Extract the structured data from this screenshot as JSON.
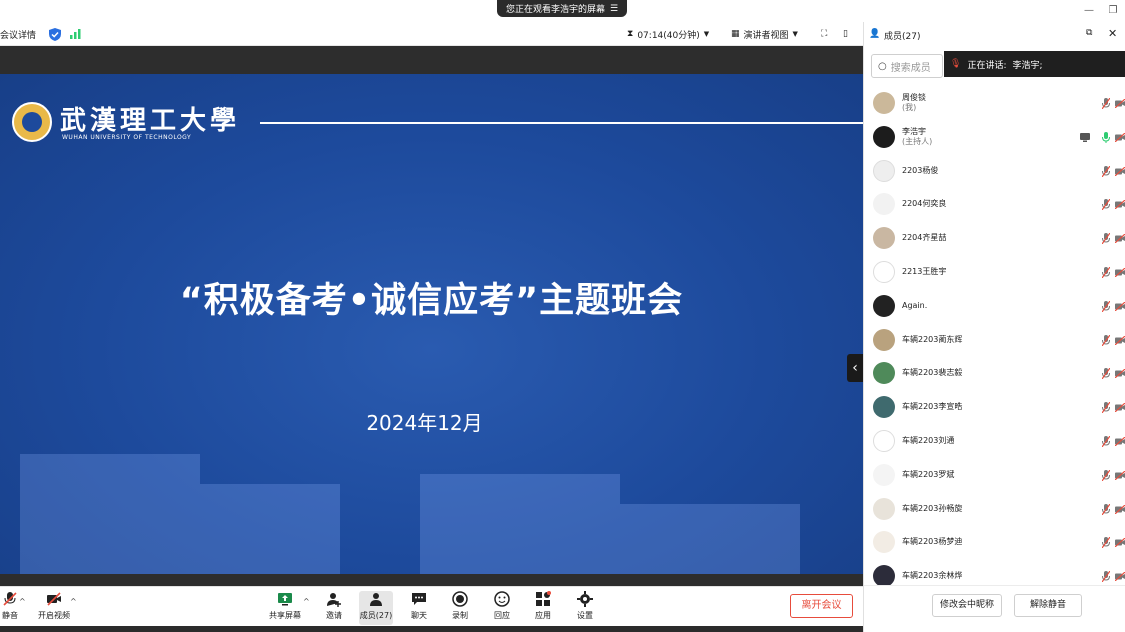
{
  "titlebar": {
    "sharing_notice": "您正在观看李浩宇的屏幕",
    "sharing_menu_icon": "menu-icon"
  },
  "toolbar": {
    "meeting_info": "会议详情",
    "timer": "07:14(40分钟)",
    "view_mode": "演讲者视图"
  },
  "slide": {
    "university_cn": "武漢理工大學",
    "university_en": "WUHAN UNIVERSITY OF TECHNOLOGY",
    "title": "“积极备考•诚信应考”主题班会",
    "date": "2024年12月"
  },
  "controls": {
    "mute": "静音",
    "video": "开启视频",
    "share": "共享屏幕",
    "invite": "邀请",
    "members": "成员(27)",
    "chat": "聊天",
    "record": "录制",
    "replay": "回应",
    "apps": "应用",
    "settings": "设置",
    "leave": "离开会议"
  },
  "panel": {
    "header": "成员(27)",
    "search_placeholder": "搜索成员",
    "speaking_label": "正在讲话:",
    "speaking_name": "李浩宇;",
    "members": [
      {
        "name": "周俊锬",
        "sub": "(我)"
      },
      {
        "name": "李浩宇",
        "sub": "(主持人)"
      },
      {
        "name": "2203杨俊",
        "sub": ""
      },
      {
        "name": "2204何奕良",
        "sub": ""
      },
      {
        "name": "2204齐星喆",
        "sub": ""
      },
      {
        "name": "2213王胜宇",
        "sub": ""
      },
      {
        "name": "Again.",
        "sub": ""
      },
      {
        "name": "车辆2203蔺东辉",
        "sub": ""
      },
      {
        "name": "车辆2203裴志毅",
        "sub": ""
      },
      {
        "name": "车辆2203李宣晧",
        "sub": ""
      },
      {
        "name": "车辆2203刘通",
        "sub": ""
      },
      {
        "name": "车辆2203罗斌",
        "sub": ""
      },
      {
        "name": "车辆2203孙畅旋",
        "sub": ""
      },
      {
        "name": "车辆2203杨梦迪",
        "sub": ""
      },
      {
        "name": "车辆2203余林烨",
        "sub": ""
      }
    ],
    "rename_button": "修改会中昵称",
    "unmute_button": "解除静音"
  },
  "colors": {
    "slide_blue": "#1d4a9c",
    "muted_red": "#e74c3c",
    "unmuted_green": "#2ecc71"
  }
}
